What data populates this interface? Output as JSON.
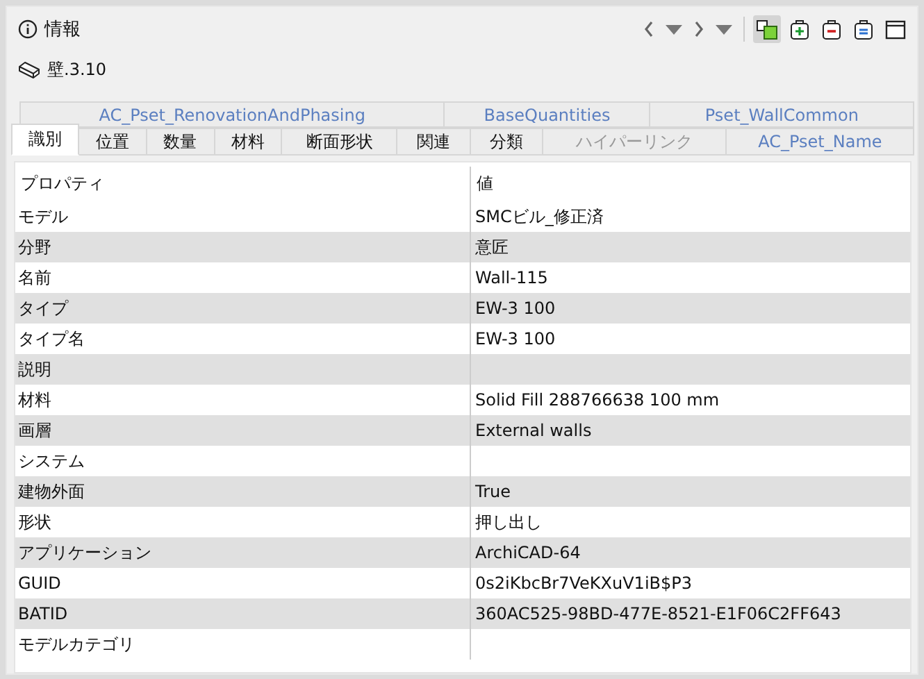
{
  "panel": {
    "title": "情報"
  },
  "toolbar": {
    "highlight_pressed": true
  },
  "object": {
    "label": "壁.3.10"
  },
  "tab_rows": [
    [
      {
        "label": "AC_Pset_RenovationAndPhasing",
        "kind": "pset",
        "selected": false,
        "disabled": false
      },
      {
        "label": "BaseQuantities",
        "kind": "pset",
        "selected": false,
        "disabled": false
      },
      {
        "label": "Pset_WallCommon",
        "kind": "pset",
        "selected": false,
        "disabled": false
      }
    ],
    [
      {
        "label": "識別",
        "kind": "builtin",
        "selected": true,
        "disabled": false
      },
      {
        "label": "位置",
        "kind": "builtin",
        "selected": false,
        "disabled": false
      },
      {
        "label": "数量",
        "kind": "builtin",
        "selected": false,
        "disabled": false
      },
      {
        "label": "材料",
        "kind": "builtin",
        "selected": false,
        "disabled": false
      },
      {
        "label": "断面形状",
        "kind": "builtin",
        "selected": false,
        "disabled": false
      },
      {
        "label": "関連",
        "kind": "builtin",
        "selected": false,
        "disabled": false
      },
      {
        "label": "分類",
        "kind": "builtin",
        "selected": false,
        "disabled": false
      },
      {
        "label": "ハイパーリンク",
        "kind": "builtin",
        "selected": false,
        "disabled": true
      },
      {
        "label": "AC_Pset_Name",
        "kind": "pset",
        "selected": false,
        "disabled": false
      }
    ]
  ],
  "table": {
    "columns": [
      "プロパティ",
      "値"
    ],
    "rows": [
      [
        "モデル",
        "SMCビル_修正済"
      ],
      [
        "分野",
        "意匠"
      ],
      [
        "名前",
        "Wall-115"
      ],
      [
        "タイプ",
        "EW-3 100"
      ],
      [
        "タイプ名",
        "EW-3 100"
      ],
      [
        "説明",
        ""
      ],
      [
        "材料",
        "Solid Fill 288766638 100 mm"
      ],
      [
        "画層",
        "External walls"
      ],
      [
        "システム",
        ""
      ],
      [
        "建物外面",
        "True"
      ],
      [
        "形状",
        "押し出し"
      ],
      [
        "アプリケーション",
        "ArchiCAD-64"
      ],
      [
        "GUID",
        "0s2iKbcBr7VeKXuV1iB$P3"
      ],
      [
        "BATID",
        "360AC525-98BD-477E-8521-E1F06C2FF643"
      ],
      [
        "モデルカテゴリ",
        ""
      ]
    ]
  }
}
